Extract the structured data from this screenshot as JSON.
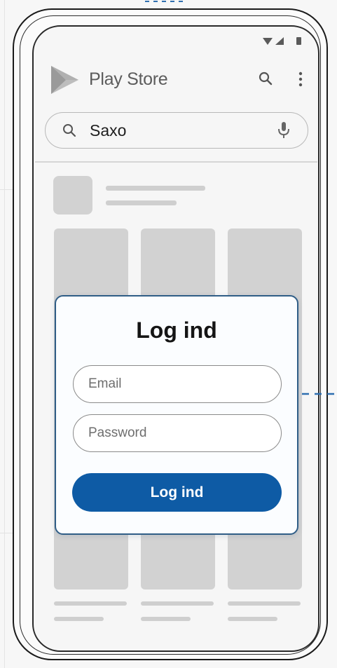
{
  "header": {
    "title": "Play Store"
  },
  "search": {
    "query": "Saxo"
  },
  "login": {
    "title": "Log ind",
    "email_placeholder": "Email",
    "password_placeholder": "Password",
    "button_label": "Log ind"
  },
  "colors": {
    "accent": "#0e5ba5",
    "card_border": "#2f5d86",
    "placeholder": "#d2d2d2"
  },
  "icons": [
    "play-store-logo-icon",
    "search-icon",
    "more-vert-icon",
    "mic-icon",
    "wifi-icon",
    "signal-icon",
    "battery-icon"
  ]
}
